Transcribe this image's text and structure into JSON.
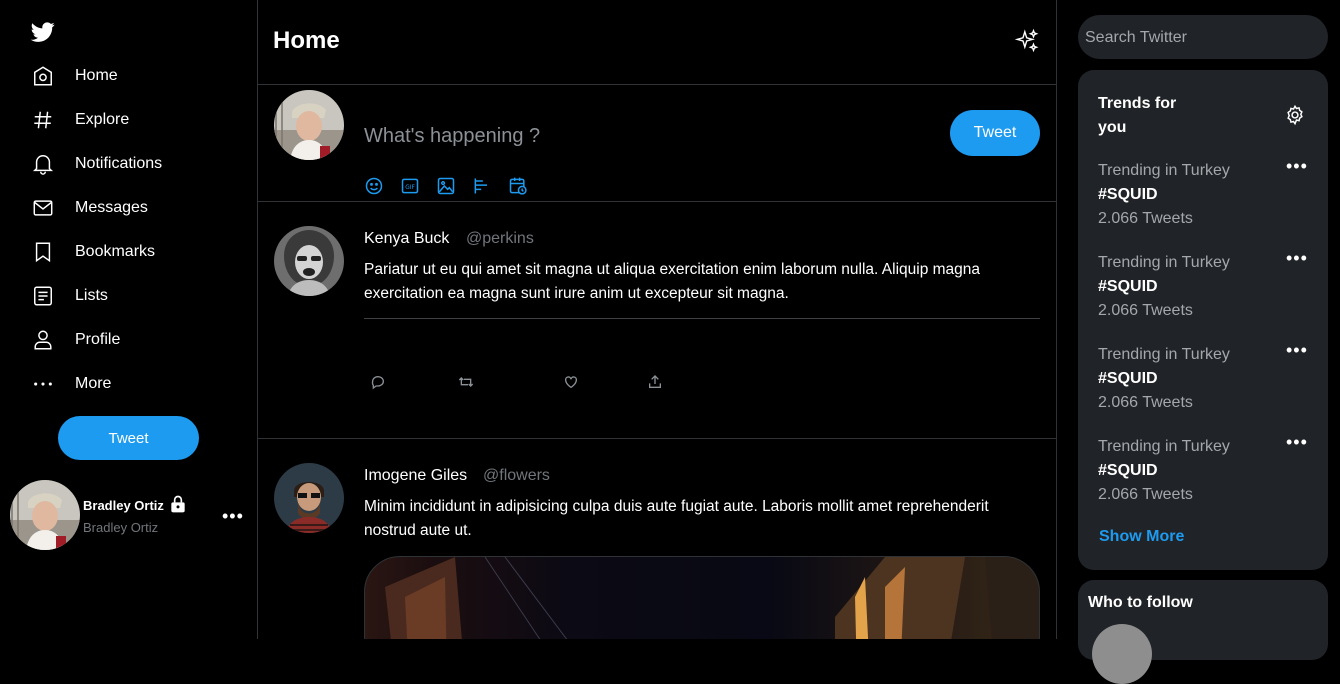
{
  "nav": {
    "items": [
      {
        "label": "Home",
        "icon": "home-icon"
      },
      {
        "label": "Explore",
        "icon": "hashtag-icon"
      },
      {
        "label": "Notifications",
        "icon": "bell-icon"
      },
      {
        "label": "Messages",
        "icon": "mail-icon"
      },
      {
        "label": "Bookmarks",
        "icon": "bookmark-icon"
      },
      {
        "label": "Lists",
        "icon": "list-icon"
      },
      {
        "label": "Profile",
        "icon": "person-icon"
      },
      {
        "label": "More",
        "icon": "more-icon"
      }
    ],
    "tweet_button": "Tweet"
  },
  "account": {
    "name": "Bradley Ortiz",
    "handle": "Bradley Ortiz"
  },
  "main": {
    "title": "Home",
    "composer": {
      "placeholder": "What's happening ?",
      "tweet_button": "Tweet"
    },
    "posts": [
      {
        "author": "Kenya Buck",
        "handle": "@perkins",
        "text": "Pariatur ut eu qui amet sit magna ut aliqua exercitation enim laborum nulla. Aliquip magna exercitation ea magna sunt irure anim ut excepteur sit magna."
      },
      {
        "author": "Imogene Giles",
        "handle": "@flowers",
        "text": "Minim incididunt in adipisicing culpa duis aute fugiat aute. Laboris mollit amet reprehenderit nostrud aute ut."
      }
    ]
  },
  "right": {
    "search_placeholder": "Search Twitter",
    "trends_title": "Trends for you",
    "trends": [
      {
        "context": "Trending in Turkey",
        "tag": "#SQUID",
        "count": "2.066 Tweets"
      },
      {
        "context": "Trending in Turkey",
        "tag": "#SQUID",
        "count": "2.066 Tweets"
      },
      {
        "context": "Trending in Turkey",
        "tag": "#SQUID",
        "count": "2.066 Tweets"
      },
      {
        "context": "Trending in Turkey",
        "tag": "#SQUID",
        "count": "2.066 Tweets"
      }
    ],
    "show_more": "Show More",
    "who_to_follow": "Who to follow"
  },
  "colors": {
    "accent": "#1d9bf0",
    "background": "#000000",
    "panel": "#202327",
    "border": "#2f3336"
  }
}
